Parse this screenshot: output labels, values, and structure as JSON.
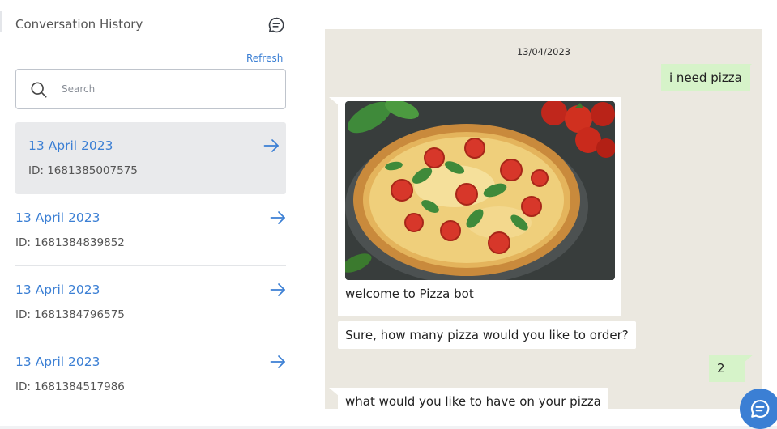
{
  "sidebar": {
    "title": "Conversation History",
    "refresh_label": "Refresh",
    "search": {
      "placeholder": "Search",
      "value": ""
    },
    "conversations": [
      {
        "date": "13 April 2023",
        "id": "ID: 1681385007575",
        "active": true
      },
      {
        "date": "13 April 2023",
        "id": "ID: 1681384839852",
        "active": false
      },
      {
        "date": "13 April 2023",
        "id": "ID: 1681384796575",
        "active": false
      },
      {
        "date": "13 April 2023",
        "id": "ID: 1681384517986",
        "active": false
      }
    ]
  },
  "chat": {
    "date": "13/04/2023",
    "messages": [
      {
        "from": "user",
        "text": "i need pizza"
      },
      {
        "from": "bot",
        "type": "image",
        "image": "pizza-photo",
        "caption": "welcome to Pizza bot"
      },
      {
        "from": "bot",
        "text": "Sure, how many pizza would you like to order?"
      },
      {
        "from": "user",
        "text": "2"
      },
      {
        "from": "bot",
        "text": "what would you like to have on your pizza"
      }
    ]
  },
  "icons": {
    "history": "chat-bubble-icon",
    "search": "search-icon",
    "arrow": "arrow-right-icon",
    "fab": "chat-bubble-icon"
  },
  "colors": {
    "accent": "#3b7fd4",
    "chat_background": "#ebe8e0",
    "user_bubble": "#d6f3c9",
    "bot_bubble": "#ffffff",
    "active_row": "#e9eaec"
  }
}
